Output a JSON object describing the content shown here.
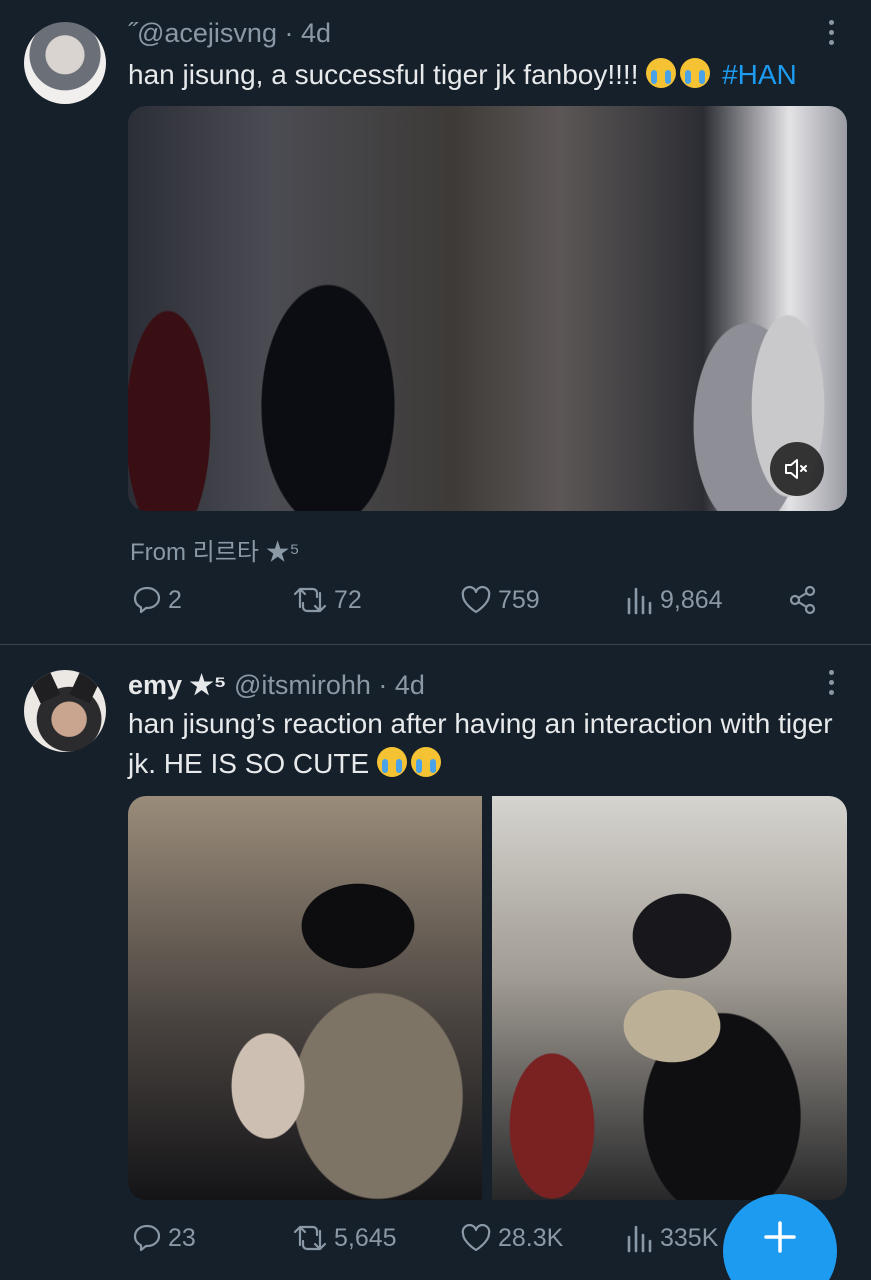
{
  "tweets": [
    {
      "handle_line": "˝@acejisvng · 4d",
      "text": "han jisung, a successful tiger jk fanboy!!!! ",
      "hashtag": "#HAN",
      "source": "From 리르타 ★⁵",
      "replies": "2",
      "retweets": "72",
      "likes": "759",
      "views": "9,864"
    },
    {
      "name": "emy ★⁵",
      "handle_line": " @itsmirohh · 4d",
      "text": "han jisung’s reaction after having an interaction with tiger jk. HE IS SO CUTE ",
      "replies": "23",
      "retweets": "5,645",
      "likes": "28.3K",
      "views": "335K"
    }
  ],
  "icons": {
    "more": "more-vertical-icon",
    "mute": "speaker-muted-icon",
    "reply": "reply-icon",
    "retweet": "retweet-icon",
    "like": "heart-icon",
    "views": "views-chart-icon",
    "share": "share-icon",
    "compose": "plus-icon",
    "emoji": "loudly-crying-face-emoji"
  },
  "colors": {
    "background": "#15202b",
    "text": "#e7e9ea",
    "muted": "#8b98a5",
    "accent": "#1d9bf0",
    "divider": "#38444d"
  }
}
